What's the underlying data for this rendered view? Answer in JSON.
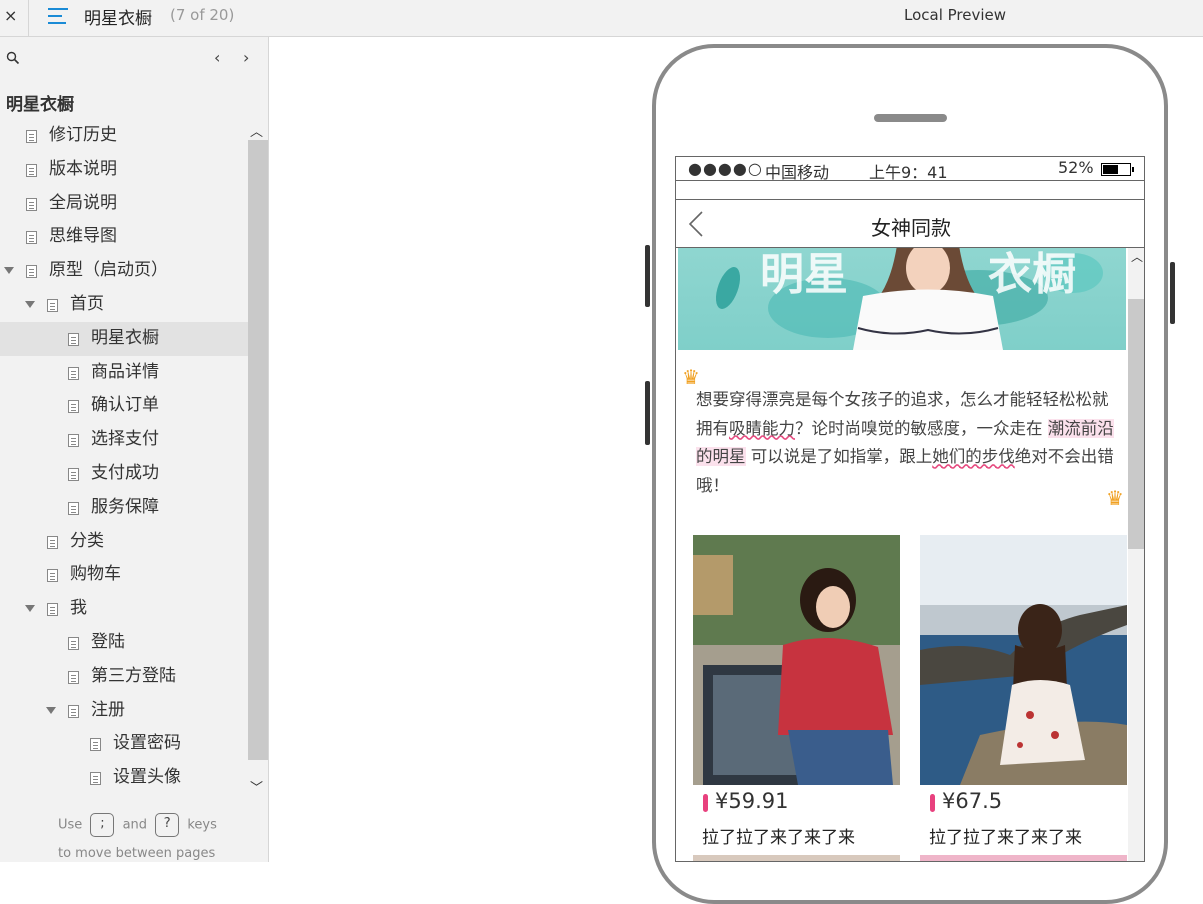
{
  "topbar": {
    "close_label": "×",
    "project_title": "明星衣橱",
    "page_count": "(7 of 20)",
    "preview_label": "Local Preview"
  },
  "sidebar": {
    "project_title": "明星衣橱",
    "prev_label": "‹",
    "next_label": "›",
    "items": [
      {
        "label": "修订历史",
        "level": 0,
        "expanded": null,
        "selected": false
      },
      {
        "label": "版本说明",
        "level": 0,
        "expanded": null,
        "selected": false
      },
      {
        "label": "全局说明",
        "level": 0,
        "expanded": null,
        "selected": false
      },
      {
        "label": "思维导图",
        "level": 0,
        "expanded": null,
        "selected": false
      },
      {
        "label": "原型（启动页）",
        "level": 0,
        "expanded": true,
        "selected": false
      },
      {
        "label": "首页",
        "level": 1,
        "expanded": true,
        "selected": false
      },
      {
        "label": "明星衣橱",
        "level": 2,
        "expanded": null,
        "selected": true
      },
      {
        "label": "商品详情",
        "level": 2,
        "expanded": null,
        "selected": false
      },
      {
        "label": "确认订单",
        "level": 2,
        "expanded": null,
        "selected": false
      },
      {
        "label": "选择支付",
        "level": 2,
        "expanded": null,
        "selected": false
      },
      {
        "label": "支付成功",
        "level": 2,
        "expanded": null,
        "selected": false
      },
      {
        "label": "服务保障",
        "level": 2,
        "expanded": null,
        "selected": false
      },
      {
        "label": "分类",
        "level": 1,
        "expanded": null,
        "selected": false
      },
      {
        "label": "购物车",
        "level": 1,
        "expanded": null,
        "selected": false
      },
      {
        "label": "我",
        "level": 1,
        "expanded": true,
        "selected": false
      },
      {
        "label": "登陆",
        "level": 2,
        "expanded": null,
        "selected": false
      },
      {
        "label": "第三方登陆",
        "level": 2,
        "expanded": null,
        "selected": false
      },
      {
        "label": "注册",
        "level": 2,
        "expanded": true,
        "selected": false
      },
      {
        "label": "设置密码",
        "level": 3,
        "expanded": null,
        "selected": false
      },
      {
        "label": "设置头像",
        "level": 3,
        "expanded": null,
        "selected": false
      }
    ],
    "hint": {
      "use": "Use",
      "key1": ";",
      "and": "and",
      "key2": "?",
      "keys": "keys",
      "line2": "to move between pages"
    }
  },
  "phone": {
    "status": {
      "signal": "●●●●○",
      "carrier": "中国移动",
      "time": "上午9：41",
      "battery": "52%"
    },
    "nav_title": "女神同款",
    "banner_text_left": "明星",
    "banner_text_right": "衣橱",
    "description": {
      "part1": "想要穿得漂亮是每个女孩子的追求，怎么才能轻轻松松就拥有",
      "part2": "吸睛能力",
      "part3": "？论时尚嗅觉的敏感度，一众走在 ",
      "part4": "潮流前沿的明星",
      "part5": " 可以说是了如指掌，跟上",
      "part6": "她们的步伐",
      "part7": "绝对不会出错哦！"
    },
    "products": [
      {
        "price": "¥59.91",
        "name": "拉了拉了来了来了来"
      },
      {
        "price": "¥67.5",
        "name": "拉了拉了来了来了来"
      }
    ]
  },
  "colors": {
    "accent": "#1a8bd6",
    "price_marker": "#e8417e",
    "highlight": "#fbe1ec",
    "banner": "#8fd6d0"
  }
}
